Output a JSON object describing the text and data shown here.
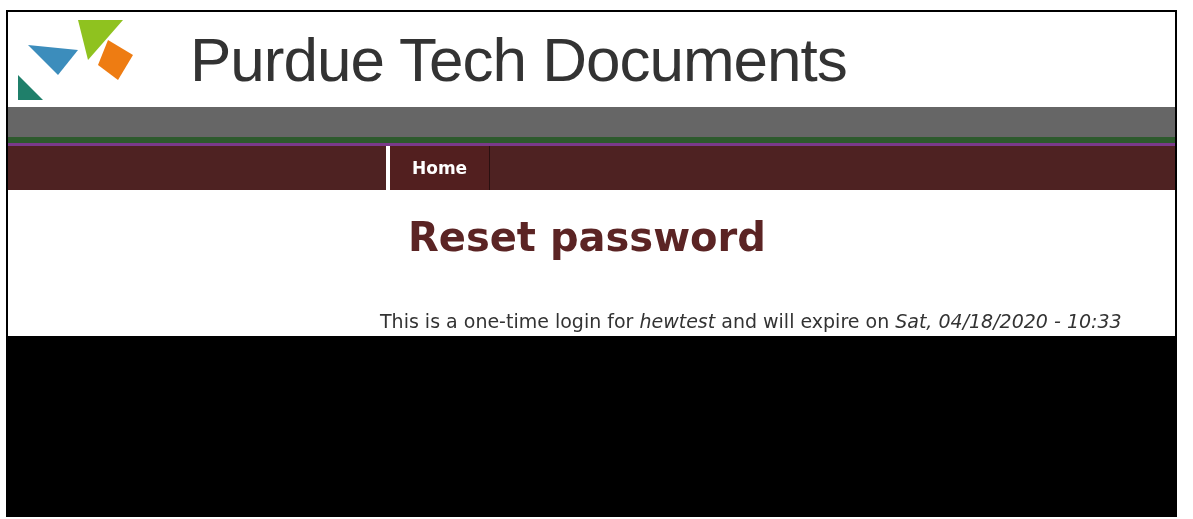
{
  "header": {
    "site_title": "Purdue Tech Documents"
  },
  "nav": {
    "items": [
      {
        "label": "Home",
        "selected": true
      }
    ]
  },
  "page": {
    "title": "Reset password",
    "message": "This is a one-time login for *hewtest* and will expire on *Sat, 04/18/2020 - 10:33*"
  }
}
